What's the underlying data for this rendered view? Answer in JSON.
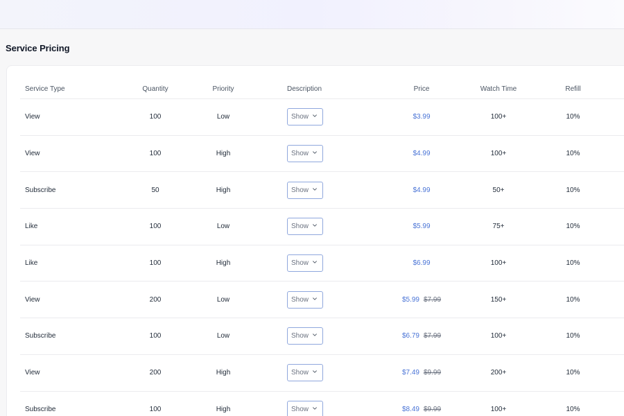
{
  "section": {
    "title": "Service Pricing"
  },
  "table": {
    "headers": {
      "service_type": "Service Type",
      "quantity": "Quantity",
      "priority": "Priority",
      "description": "Description",
      "price": "Price",
      "watch_time": "Watch Time",
      "refill": "Refill"
    },
    "rows": [
      {
        "service_type": "View",
        "quantity": "100",
        "priority": "Low",
        "description_button": "Show",
        "price": "$3.99",
        "original_price": "",
        "watch_time": "100+",
        "refill": "10%"
      },
      {
        "service_type": "View",
        "quantity": "100",
        "priority": "High",
        "description_button": "Show",
        "price": "$4.99",
        "original_price": "",
        "watch_time": "100+",
        "refill": "10%"
      },
      {
        "service_type": "Subscribe",
        "quantity": "50",
        "priority": "High",
        "description_button": "Show",
        "price": "$4.99",
        "original_price": "",
        "watch_time": "50+",
        "refill": "10%"
      },
      {
        "service_type": "Like",
        "quantity": "100",
        "priority": "Low",
        "description_button": "Show",
        "price": "$5.99",
        "original_price": "",
        "watch_time": "75+",
        "refill": "10%"
      },
      {
        "service_type": "Like",
        "quantity": "100",
        "priority": "High",
        "description_button": "Show",
        "price": "$6.99",
        "original_price": "",
        "watch_time": "100+",
        "refill": "10%"
      },
      {
        "service_type": "View",
        "quantity": "200",
        "priority": "Low",
        "description_button": "Show",
        "price": "$5.99",
        "original_price": "$7.99",
        "watch_time": "150+",
        "refill": "10%"
      },
      {
        "service_type": "Subscribe",
        "quantity": "100",
        "priority": "Low",
        "description_button": "Show",
        "price": "$6.79",
        "original_price": "$7.99",
        "watch_time": "100+",
        "refill": "10%"
      },
      {
        "service_type": "View",
        "quantity": "200",
        "priority": "High",
        "description_button": "Show",
        "price": "$7.49",
        "original_price": "$9.99",
        "watch_time": "200+",
        "refill": "10%"
      },
      {
        "service_type": "Subscribe",
        "quantity": "100",
        "priority": "High",
        "description_button": "Show",
        "price": "$8.49",
        "original_price": "$9.99",
        "watch_time": "100+",
        "refill": "10%"
      }
    ]
  },
  "icons": {
    "dropdown": "chevron-down-icon"
  },
  "colors": {
    "price_accent": "#4a74d6",
    "button_border": "#8fa7dd"
  }
}
